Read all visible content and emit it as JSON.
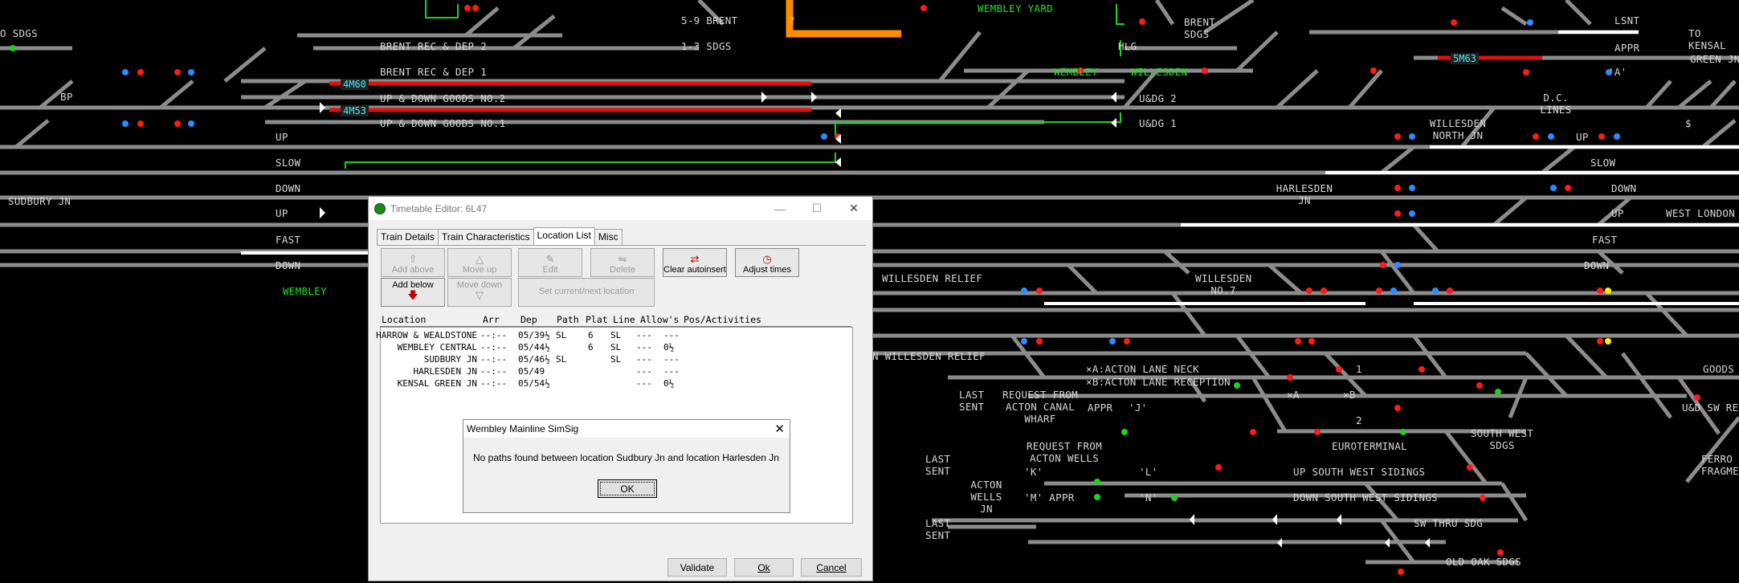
{
  "diagram_labels": {
    "sdgs_left": "O SDGS",
    "bp": "BP",
    "brent_rec_dep_2": "BRENT REC & DEP 2",
    "brent_rec_dep_1": "BRENT REC & DEP 1",
    "up_down_goods_2": "UP & DOWN GOODS NO.2",
    "up_down_goods_1": "UP & DOWN GOODS NO.1",
    "up_1": "UP",
    "slow_1": "SLOW",
    "down_1": "DOWN",
    "sudbury_jn": "SUDBURY JN",
    "up_2": "UP",
    "fast_1": "FAST",
    "down_2": "DOWN",
    "wembley_left": "WEMBLEY",
    "s9_brent": "5-9 BRENT",
    "s13_sdgs": "1-3 SDGS",
    "wembley_yard": "WEMBLEY YARD",
    "brent_sdgs": "BRENT SDGS",
    "hlg": "HLG",
    "wembley_mid": "WEMBLEY",
    "willesden": "WILLESDEN",
    "udg2": "U&DG 2",
    "udg1": "U&DG 1",
    "lsnt": "LSNT",
    "to_kensal": "TO KENSAL",
    "appr_top": "APPR",
    "green_jn": "GREEN JN",
    "a_quote": "'A'",
    "dc_lines": "D.C. LINES",
    "willesden_north_jn": "WILLESDEN NORTH JN",
    "up_3": "UP",
    "up_4": "UP",
    "dollar": "$",
    "slow_2": "SLOW",
    "harlesden_jn": "HARLESDEN JN",
    "down_3": "DOWN",
    "up_5": "UP",
    "up_6": "UP",
    "west_london": "WEST LONDON",
    "fast_2": "FAST",
    "down_4": "DOWN",
    "willesden_relief_1": "WILLESDEN RELIEF",
    "willesden_no7": "WILLESDEN NO.7",
    "willesden_relief_2": "N WILLESDEN RELIEF",
    "acton_lane_neck": "×A:ACTON LANE NECK",
    "acton_lane_reception": "×B:ACTON LANE RECEPTION",
    "goods": "GOODS",
    "last_sent_1": "LAST SENT",
    "request_from_acton_canal": "REQUEST FROM ACTON CANAL WHARF",
    "appr_mid": "APPR",
    "j_quote": "'J'",
    "one": "1",
    "two": "2",
    "xa": "×A",
    "xb": "×B",
    "udsw_rev": "U&D SW REV",
    "euroterminal": "EUROTERMINAL",
    "south_west_sdgs": "SOUTH WEST SDGS",
    "last_sent_2": "LAST SENT",
    "request_from_acton_wells": "REQUEST FROM ACTON WELLS",
    "k_quote": "'K'",
    "l_quote": "'L'",
    "up_south_west_sidings": "UP SOUTH WEST SIDINGS",
    "down_south_west_sidings": "DOWN SOUTH WEST SIDINGS",
    "acton_wells_jn": "ACTON WELLS JN",
    "m_appr": "'M' APPR",
    "n_quote": "'N'",
    "last_sent_3": "LAST SENT",
    "sw_thru_sdg": "SW THRU SDG",
    "old_oak_sdgs": "OLD OAK SDGS",
    "ferro_fragmen": "FERRO FRAGMEN"
  },
  "berths": {
    "b1": "4M60",
    "b2": "4M53",
    "b3": "5M63"
  },
  "timetable_editor": {
    "title": "Timetable Editor: 6L47",
    "tabs": [
      "Train Details",
      "Train Characteristics",
      "Location List",
      "Misc"
    ],
    "buttons": {
      "add_above": "Add above",
      "add_below": "Add below",
      "move_up": "Move up",
      "move_down": "Move down",
      "edit": "Edit",
      "delete": "Delete",
      "set_current": "Set current/next location",
      "clear_autoinsert": "Clear autoinsert",
      "adjust_times": "Adjust times"
    },
    "columns": [
      "Location",
      "Arr",
      "Dep",
      "Path",
      "Plat",
      "Line",
      "Allow's",
      "Pos/Activities"
    ],
    "rows": [
      {
        "location": "HARROW & WEALDSTONE",
        "arr": "--:--",
        "dep": "05/39½",
        "path": "SL",
        "plat": "6",
        "line": "SL",
        "allow": "---",
        "pos": "---"
      },
      {
        "location": "WEMBLEY CENTRAL",
        "arr": "--:--",
        "dep": "05/44½",
        "path": "",
        "plat": "6",
        "line": "SL",
        "allow": "---",
        "pos": "0½"
      },
      {
        "location": "SUDBURY JN",
        "arr": "--:--",
        "dep": "05/46½",
        "path": "SL",
        "plat": "",
        "line": "SL",
        "allow": "---",
        "pos": "---"
      },
      {
        "location": "HARLESDEN JN",
        "arr": "--:--",
        "dep": "05/49",
        "path": "",
        "plat": "",
        "line": "",
        "allow": "---",
        "pos": "---"
      },
      {
        "location": "KENSAL GREEN JN",
        "arr": "--:--",
        "dep": "05/54½",
        "path": "",
        "plat": "",
        "line": "",
        "allow": "---",
        "pos": "0½"
      }
    ],
    "validate": "Validate",
    "ok": "Ok",
    "cancel": "Cancel"
  },
  "message_box": {
    "title": "Wembley Mainline SimSig",
    "text": "No paths found between location Sudbury Jn and location Harlesden Jn",
    "ok": "OK"
  },
  "unknown_marker": "?",
  "colors": {
    "track": "#8c8c8c",
    "route_set": "#e01010",
    "platform": "#ffffff",
    "signal_red": "#ff1a1a",
    "signal_blue": "#2a8cff",
    "overlap_green": "#20d020",
    "berth_text": "#40f0ff",
    "highlight_orange": "#ff8c00"
  }
}
